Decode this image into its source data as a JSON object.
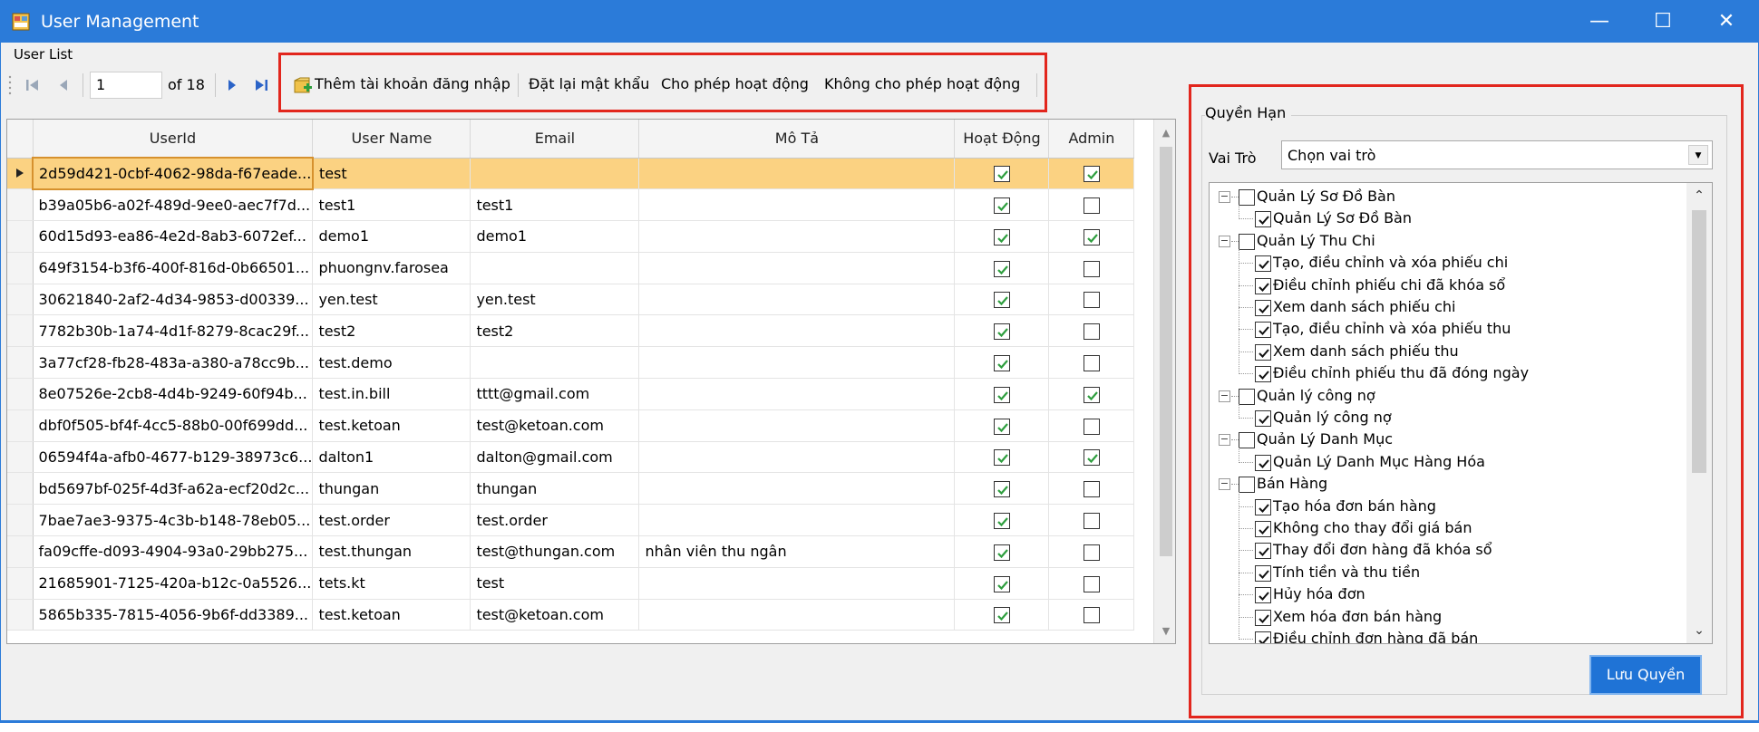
{
  "window": {
    "title": "User Management",
    "controls": [
      "—",
      "☐",
      "✕"
    ]
  },
  "group_label": "User List",
  "navigator": {
    "position": "1",
    "of_label": "of 18"
  },
  "toolbar": {
    "add_login": "Thêm tài khoản đăng nhập",
    "reset_password": "Đặt lại mật khẩu",
    "activate": "Cho phép hoạt động",
    "deactivate": "Không cho phép hoạt động"
  },
  "grid": {
    "columns": [
      "UserId",
      "User Name",
      "Email",
      "Mô Tả",
      "Hoạt Động",
      "Admin"
    ],
    "rows": [
      {
        "id": "2d59d421-0cbf-4062-98da-f67eade...",
        "name": "test",
        "email": "",
        "desc": "",
        "active": true,
        "admin": true
      },
      {
        "id": "b39a05b6-a02f-489d-9ee0-aec7f7d...",
        "name": "test1",
        "email": "test1",
        "desc": "",
        "active": true,
        "admin": false
      },
      {
        "id": "60d15d93-ea86-4e2d-8ab3-6072ef...",
        "name": "demo1",
        "email": "demo1",
        "desc": "",
        "active": true,
        "admin": true
      },
      {
        "id": "649f3154-b3f6-400f-816d-0b66501...",
        "name": "phuongnv.farosea",
        "email": "",
        "desc": "",
        "active": true,
        "admin": false
      },
      {
        "id": "30621840-2af2-4d34-9853-d00339...",
        "name": "yen.test",
        "email": "yen.test",
        "desc": "",
        "active": true,
        "admin": false
      },
      {
        "id": "7782b30b-1a74-4d1f-8279-8cac29f...",
        "name": "test2",
        "email": "test2",
        "desc": "",
        "active": true,
        "admin": false
      },
      {
        "id": "3a77cf28-fb28-483a-a380-a78cc9b...",
        "name": "test.demo",
        "email": "",
        "desc": "",
        "active": true,
        "admin": false
      },
      {
        "id": "8e07526e-2cb8-4d4b-9249-60f94b...",
        "name": "test.in.bill",
        "email": "tttt@gmail.com",
        "desc": "",
        "active": true,
        "admin": true
      },
      {
        "id": "dbf0f505-bf4f-4cc5-88b0-00f699dd...",
        "name": "test.ketoan",
        "email": "test@ketoan.com",
        "desc": "",
        "active": true,
        "admin": false
      },
      {
        "id": "06594f4a-afb0-4677-b129-38973c6...",
        "name": "dalton1",
        "email": "dalton@gmail.com",
        "desc": "",
        "active": true,
        "admin": true
      },
      {
        "id": "bd5697bf-025f-4d3f-a62a-ecf20d2c...",
        "name": "thungan",
        "email": "thungan",
        "desc": "",
        "active": true,
        "admin": false
      },
      {
        "id": "7bae7ae3-9375-4c3b-b148-78eb05...",
        "name": "test.order",
        "email": "test.order",
        "desc": "",
        "active": true,
        "admin": false
      },
      {
        "id": "fa09cffe-d093-4904-93a0-29bb275...",
        "name": "test.thungan",
        "email": "test@thungan.com",
        "desc": "nhân viên thu ngân",
        "active": true,
        "admin": false
      },
      {
        "id": "21685901-7125-420a-b12c-0a5526...",
        "name": "tets.kt",
        "email": "test",
        "desc": "",
        "active": true,
        "admin": false
      },
      {
        "id": "5865b335-7815-4056-9b6f-dd3389...",
        "name": "test.ketoan",
        "email": "test@ketoan.com",
        "desc": "",
        "active": true,
        "admin": false
      }
    ]
  },
  "permissions": {
    "title": "Quyền Hạn",
    "role_label": "Vai Trò",
    "role_value": "Chọn vai trò",
    "save_label": "Lưu Quyền",
    "tree": [
      {
        "label": "Quản Lý Sơ Đồ Bàn",
        "children": [
          "Quản Lý Sơ Đồ Bàn"
        ]
      },
      {
        "label": "Quản Lý Thu Chi",
        "children": [
          "Tạo, điều chỉnh và xóa phiếu chi",
          "Điều chỉnh phiếu chi đã khóa sổ",
          "Xem danh sách phiếu chi",
          "Tạo, điều chỉnh và xóa phiếu thu",
          "Xem danh sách phiếu thu",
          "Điều chỉnh phiếu thu đã đóng ngày"
        ]
      },
      {
        "label": "Quản lý công nợ",
        "children": [
          "Quản lý công nợ"
        ]
      },
      {
        "label": "Quản Lý Danh Mục",
        "children": [
          "Quản Lý Danh Mục Hàng Hóa"
        ]
      },
      {
        "label": "Bán Hàng",
        "children": [
          "Tạo hóa đơn bán hàng",
          "Không cho thay đổi giá bán",
          "Thay đổi đơn hàng đã khóa sổ",
          "Tính tiền và thu tiền",
          "Hủy hóa đơn",
          "Xem hóa đơn bán hàng",
          "Điều chỉnh đơn hàng đã bán"
        ]
      }
    ]
  },
  "colors": {
    "titlebar": "#2b7bd9",
    "selected_row": "#fbd282",
    "highlight": "#e2261d",
    "check": "#2e9e3e",
    "save_button": "#1f73d6"
  }
}
